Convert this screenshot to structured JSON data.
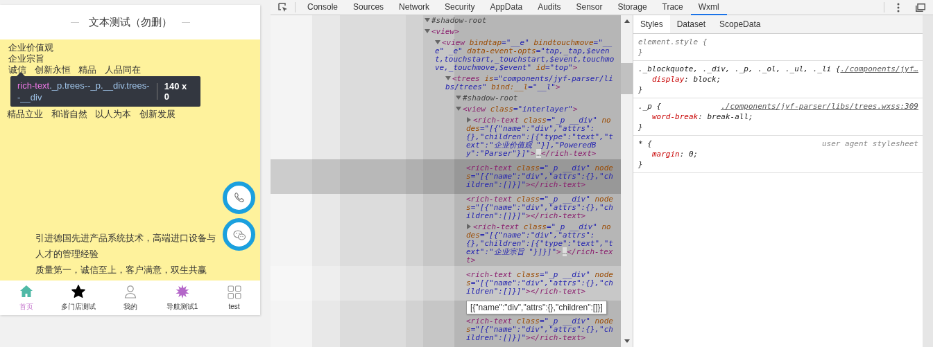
{
  "phone": {
    "title": "文本测试（勿删）",
    "lines": [
      "企业价值观",
      "企业宗旨",
      "诚信 创新永恒 精品 人品同在"
    ],
    "tooltip": {
      "tag": "rich-text",
      "classes": "._p.trees--_p.__div.trees--__div",
      "size": "140 x 0"
    },
    "line_below_tooltip": "精品立业 和谐自然 以人为本 创新发展",
    "bottom_lines": [
      "引进德国先进产品系统技术，高端进口设备与",
      "人才的管理经验",
      "质量第一，诚信至上，客户满意，双生共赢"
    ],
    "float_buttons": [
      {
        "kind": "phone"
      },
      {
        "kind": "wechat"
      }
    ],
    "tab_bar": [
      {
        "label": "首页",
        "kind": "home",
        "selected": true
      },
      {
        "label": "多门店测试",
        "kind": "star",
        "selected": false
      },
      {
        "label": "我的",
        "kind": "person",
        "selected": false
      },
      {
        "label": "导航测试1",
        "kind": "burst",
        "selected": false
      },
      {
        "label": "test",
        "kind": "grid",
        "selected": false
      }
    ]
  },
  "devtools": {
    "tabs": [
      {
        "label": "Console",
        "selected": false
      },
      {
        "label": "Sources",
        "selected": false
      },
      {
        "label": "Network",
        "selected": false
      },
      {
        "label": "Security",
        "selected": false
      },
      {
        "label": "AppData",
        "selected": false
      },
      {
        "label": "Audits",
        "selected": false
      },
      {
        "label": "Sensor",
        "selected": false
      },
      {
        "label": "Storage",
        "selected": false
      },
      {
        "label": "Trace",
        "selected": false
      },
      {
        "label": "Wxml",
        "selected": true
      }
    ],
    "dom_tree": [
      {
        "open": "#shadow-root",
        "expanded": true
      },
      {
        "open": "<view>",
        "expanded": true,
        "children": [
          {
            "open": "<view bindtap=\"__e\" bindtouchmove=\"__e\" _e\" data-event-opts=\"tap,_tap,$event,touchstart,_touchstart,$event,touchmove,_touchmove,$event\" id=\"top\">",
            "expanded": true,
            "children": [
              {
                "open": "<trees is=\"components/jyf-parser/libs/trees\" bind:__l=\"__l\">",
                "expanded": true,
                "children": [
                  {
                    "open": "#shadow-root",
                    "expanded": true
                  },
                  {
                    "open": "<view class=\"interlayer\">",
                    "expanded": true,
                    "children": [
                      {
                        "open": "<rich-text class=\"_p __div\" nodes=\"[{\"name\":\"div\",\"attrs\":{},\"children\":[{\"type\":\"text\",\"text\":\"企业价值观 \"}],\"PoweredBy\":\"Parser\"}]\">",
                        "ellipsis": "…",
                        "close": "</rich-text>",
                        "expanded": false,
                        "selected": false,
                        "hovered": false
                      },
                      {
                        "open": "<rich-text class=\"_p __div\" nodes=\"[{\"name\":\"div\",\"attrs\":{},\"children\":[]}]\">",
                        "close": "</rich-text>",
                        "selected": true,
                        "hovered": false
                      },
                      {
                        "open": "<rich-text class=\"_p __div\" nodes=\"[{\"name\":\"div\",\"attrs\":{},\"children\":[]}]\">",
                        "close": "</rich-text>",
                        "selected": false,
                        "hovered": false
                      },
                      {
                        "open": "<rich-text class=\"_p __div\" nodes=\"[{\"name\":\"div\",\"attrs\":{},\"children\":[{\"type\":\"text\",\"text\":\"企业宗旨 \"}]}]\">",
                        "ellipsis": "…",
                        "close": "</rich-text>",
                        "expanded": false,
                        "selected": false,
                        "hovered": false
                      },
                      {
                        "open": "<rich-text class=\"_p __div\" nodes=\"[{\"name\":\"div\",\"attrs\":{},\"children\":[]}]\">",
                        "close": "</rich-text>",
                        "selected": false,
                        "hovered": true
                      },
                      {
                        "open": "<rich-text class=\"_p __div\" nodes=\"[{\"name\":\"div\",\"attrs\":{},\"children\":[]}]\">",
                        "close": "</rich-text>",
                        "selected": false,
                        "hovered": false
                      }
                    ]
                  }
                ]
              }
            ]
          }
        ]
      }
    ],
    "dom_tooltip": "[{\"name\":\"div\",\"attrs\":{},\"children\":[]}]",
    "side_tabs": [
      {
        "label": "Styles",
        "selected": true
      },
      {
        "label": "Dataset",
        "selected": false
      },
      {
        "label": "ScopeData",
        "selected": false
      }
    ],
    "style_rules": [
      {
        "kind": "inline",
        "selector": "element.style {",
        "close": "}"
      },
      {
        "kind": "file",
        "selector": "._blockquote, ._div, ._p, ._ol, ._ul, ._li {",
        "source": "./components/jyf…",
        "props": [
          "display: block;"
        ],
        "close": "}"
      },
      {
        "kind": "file",
        "selector": "._p {",
        "source": "./components/jyf-parser/libs/trees.wxss:309",
        "props": [
          "word-break: break-all;"
        ],
        "close": "}"
      },
      {
        "kind": "agent",
        "selector": "* {",
        "source": "user agent stylesheet",
        "props": [
          "margin: 0;"
        ],
        "close": "}"
      }
    ]
  }
}
